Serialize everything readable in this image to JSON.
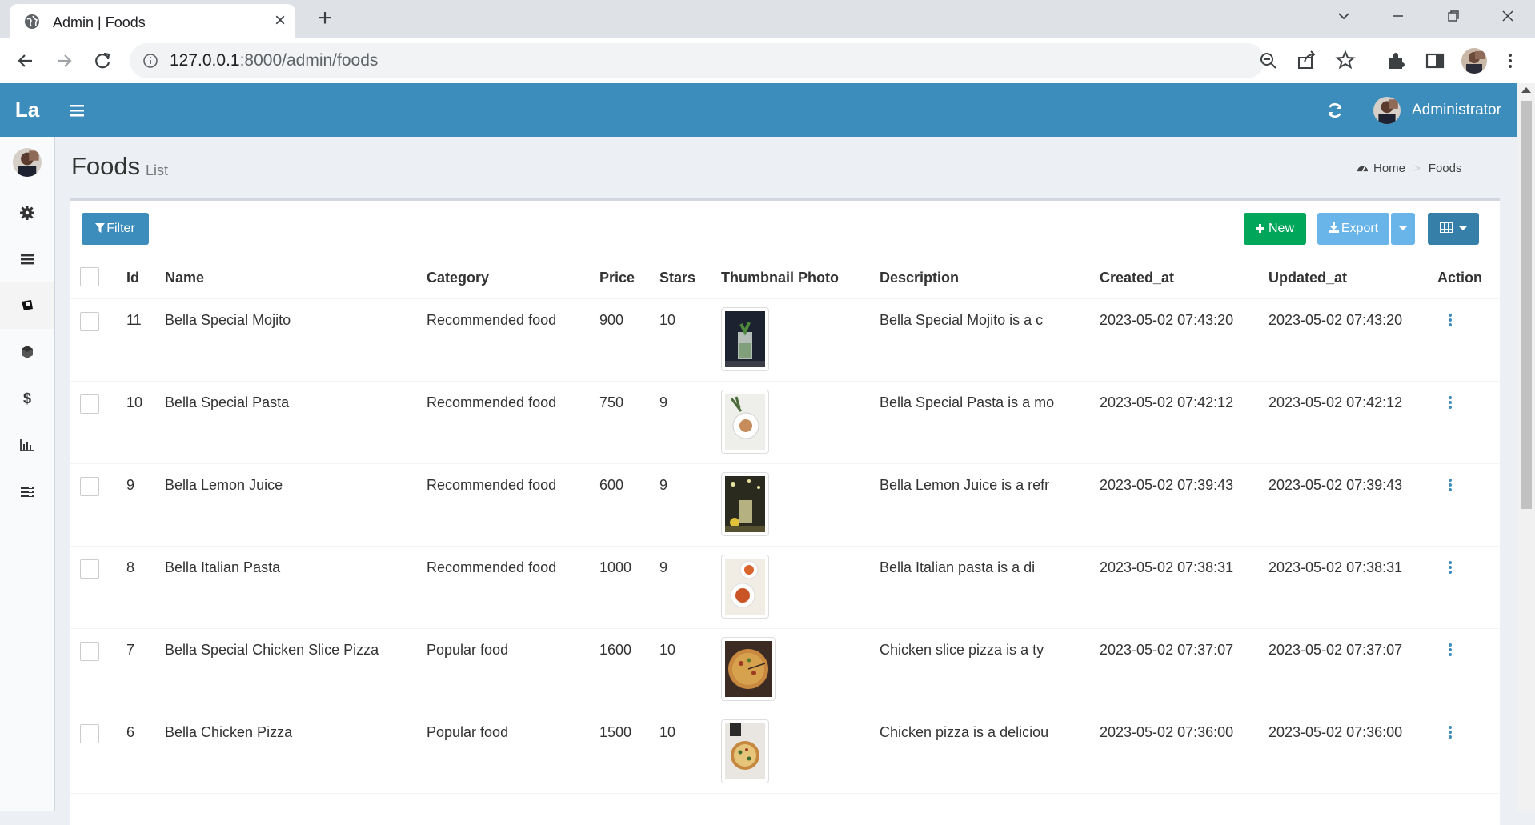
{
  "browser": {
    "tab_title": "Admin | Foods",
    "url_host": "127.0.0.1",
    "url_rest": ":8000/admin/foods"
  },
  "header": {
    "logo": "La",
    "user_name": "Administrator",
    "color": "#3c8dbc"
  },
  "sidebar": {
    "items": [
      {
        "icon": "gear-icon"
      },
      {
        "icon": "list-icon"
      },
      {
        "icon": "food-icon"
      },
      {
        "icon": "cube-icon"
      },
      {
        "icon": "dollar-icon"
      },
      {
        "icon": "bar-chart-icon"
      },
      {
        "icon": "table-list-icon"
      }
    ]
  },
  "page": {
    "title": "Foods",
    "subtitle": "List",
    "breadcrumb": [
      "Home",
      "Foods"
    ]
  },
  "toolbar": {
    "filter_label": "Filter",
    "new_label": "New",
    "export_label": "Export"
  },
  "table": {
    "columns": [
      "Id",
      "Name",
      "Category",
      "Price",
      "Stars",
      "Thumbnail Photo",
      "Description",
      "Created_at",
      "Updated_at",
      "Action"
    ],
    "rows": [
      {
        "id": "11",
        "name": "Bella Special Mojito",
        "category": "Recommended food",
        "price": "900",
        "stars": "10",
        "description": "Bella Special Mojito is a c",
        "created_at": "2023-05-02 07:43:20",
        "updated_at": "2023-05-02 07:43:20"
      },
      {
        "id": "10",
        "name": "Bella Special Pasta",
        "category": "Recommended food",
        "price": "750",
        "stars": "9",
        "description": "Bella Special Pasta is a mo",
        "created_at": "2023-05-02 07:42:12",
        "updated_at": "2023-05-02 07:42:12"
      },
      {
        "id": "9",
        "name": "Bella Lemon Juice",
        "category": "Recommended food",
        "price": "600",
        "stars": "9",
        "description": "Bella Lemon Juice is a refr",
        "created_at": "2023-05-02 07:39:43",
        "updated_at": "2023-05-02 07:39:43"
      },
      {
        "id": "8",
        "name": "Bella Italian Pasta",
        "category": "Recommended food",
        "price": "1000",
        "stars": "9",
        "description": "Bella Italian pasta is a di",
        "created_at": "2023-05-02 07:38:31",
        "updated_at": "2023-05-02 07:38:31"
      },
      {
        "id": "7",
        "name": "Bella Special Chicken Slice Pizza",
        "category": "Popular food",
        "price": "1600",
        "stars": "10",
        "description": "Chicken slice pizza is a ty",
        "created_at": "2023-05-02 07:37:07",
        "updated_at": "2023-05-02 07:37:07"
      },
      {
        "id": "6",
        "name": "Bella Chicken Pizza",
        "category": "Popular food",
        "price": "1500",
        "stars": "10",
        "description": "Chicken pizza is a deliciou",
        "created_at": "2023-05-02 07:36:00",
        "updated_at": "2023-05-02 07:36:00"
      }
    ]
  }
}
